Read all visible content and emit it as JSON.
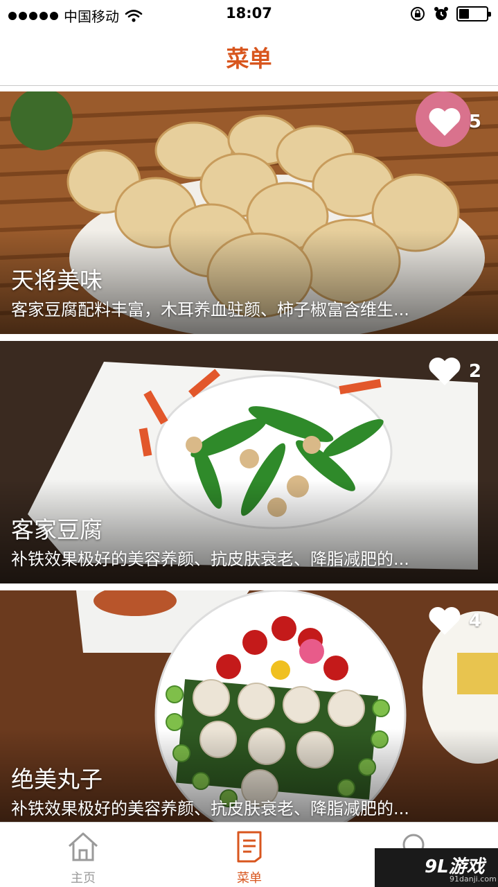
{
  "status_bar": {
    "carrier": "中国移动",
    "time": "18:07"
  },
  "nav": {
    "title": "菜单"
  },
  "menu_items": [
    {
      "title": "天将美味",
      "description": "客家豆腐配料丰富，木耳养血驻颜、柿子椒富含维生...",
      "likes": "5"
    },
    {
      "title": "客家豆腐",
      "description": "补铁效果极好的美容养颜、抗皮肤衰老、降脂减肥的...",
      "likes": "2"
    },
    {
      "title": "绝美丸子",
      "description": "补铁效果极好的美容养颜、抗皮肤衰老、降脂减肥的...",
      "likes": "4"
    }
  ],
  "tab_bar": {
    "tabs": [
      {
        "label": "主页",
        "icon": "home-icon"
      },
      {
        "label": "菜单",
        "icon": "menu-document-icon"
      },
      {
        "label": "",
        "icon": "search-icon"
      }
    ],
    "active_color": "#d8561e",
    "inactive_color": "#9a9a9a"
  },
  "watermark": {
    "logo": "9L游戏",
    "site": "91danji.com"
  }
}
